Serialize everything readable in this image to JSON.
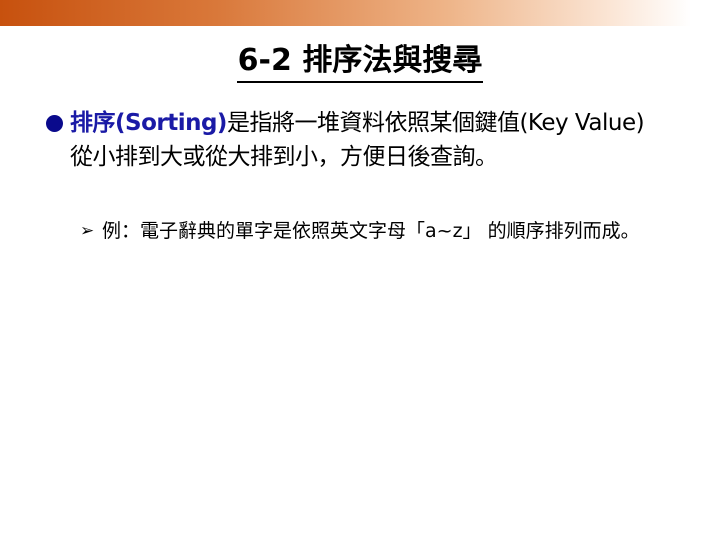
{
  "slide": {
    "title": "6-2 排序法與搜尋",
    "bullet1": {
      "term": "排序(Sorting)",
      "text": "是指將一堆資料依照某個鍵值(Key Value)從小排到大或從大排到小，方便日後查詢。"
    },
    "bullet2": {
      "text": "例：電子辭典的單字是依照英文字母「a~z」 的順序排列而成。"
    }
  },
  "theme": {
    "accent": "#c7510e",
    "term_color": "#1a1aa6",
    "bullet_color": "#0a0a8c"
  },
  "icons": {
    "bullet1": "filled-circle-bullet-icon",
    "bullet2": "arrowhead-bullet-icon"
  }
}
